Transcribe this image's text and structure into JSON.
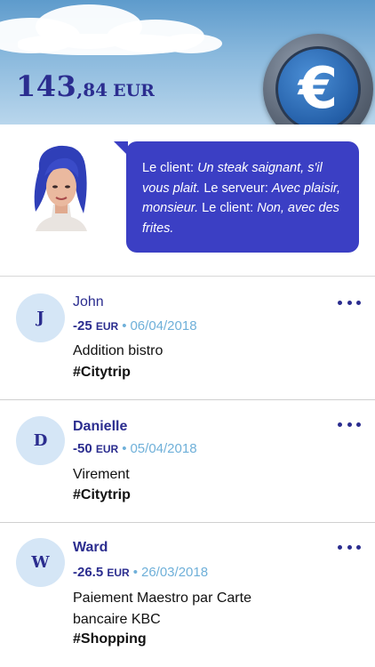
{
  "balance": {
    "integer": "143",
    "decimal": ",84",
    "currency": "EUR"
  },
  "coin": {
    "symbol": "€",
    "icon": "euro-coin-icon"
  },
  "speech": {
    "avatar": "woman-avatar",
    "segments": [
      {
        "text": "Le client: ",
        "italic": false
      },
      {
        "text": "Un steak saignant, s'il vous plait.",
        "italic": true
      },
      {
        "text": " Le serveur: ",
        "italic": false
      },
      {
        "text": "Avec plaisir, monsieur.",
        "italic": true
      },
      {
        "text": " Le client: ",
        "italic": false
      },
      {
        "text": "Non, avec des frites.",
        "italic": true
      }
    ]
  },
  "transactions": [
    {
      "initial": "J",
      "name": "John",
      "amount": "-25",
      "currency": "EUR",
      "separator": "•",
      "date": "06/04/2018",
      "description": "Addition bistro",
      "tag": "#Citytrip"
    },
    {
      "initial": "D",
      "name": "Danielle",
      "amount": "-50",
      "currency": "EUR",
      "separator": "•",
      "date": "05/04/2018",
      "description": "Virement",
      "tag": "#Citytrip"
    },
    {
      "initial": "W",
      "name": "Ward",
      "amount": "-26.5",
      "currency": "EUR",
      "separator": "•",
      "date": "26/03/2018",
      "description": "Paiement Maestro par Carte bancaire KBC",
      "tag": "#Shopping"
    }
  ],
  "colors": {
    "accent": "#2b2d8f",
    "bubble": "#3b3fc4",
    "date": "#6fb0d9",
    "avatarBg": "#d5e6f6"
  }
}
